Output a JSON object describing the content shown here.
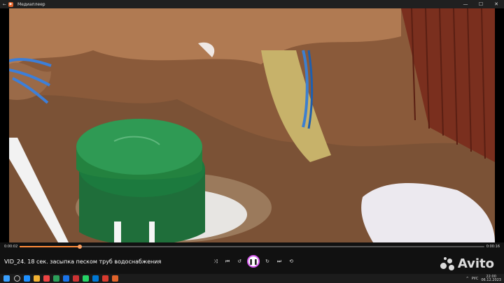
{
  "window": {
    "title": "Медиаплеер",
    "back_glyph": "←",
    "minimize": "—",
    "maximize": "☐",
    "close": "✕"
  },
  "player": {
    "current_time": "0:00:02",
    "duration": "0:00:16",
    "progress_fraction": 0.13,
    "video_title": "VID_24.  18 сек. засыпка песком труб водоснабжения",
    "buttons": {
      "shuffle": "⤨",
      "prev": "⏮",
      "rewind": "↺",
      "play_pause": "❚❚",
      "forward": "↻",
      "next": "⏭",
      "repeat": "⟲"
    }
  },
  "watermark": {
    "text": "Avito"
  },
  "taskbar": {
    "language": "РУС",
    "time": "22:00",
    "date": "06.12.2023",
    "tray_up": "^",
    "colors": [
      "#1e90ff",
      "#f2b233",
      "#e44",
      "#2ca05a",
      "#1a73e8",
      "#c33",
      "#25d366",
      "#0078d4",
      "#d73a2e",
      "#e0632b"
    ]
  },
  "colors": {
    "accent": "#ff8c3a",
    "play_ring": "#d75bf0"
  }
}
